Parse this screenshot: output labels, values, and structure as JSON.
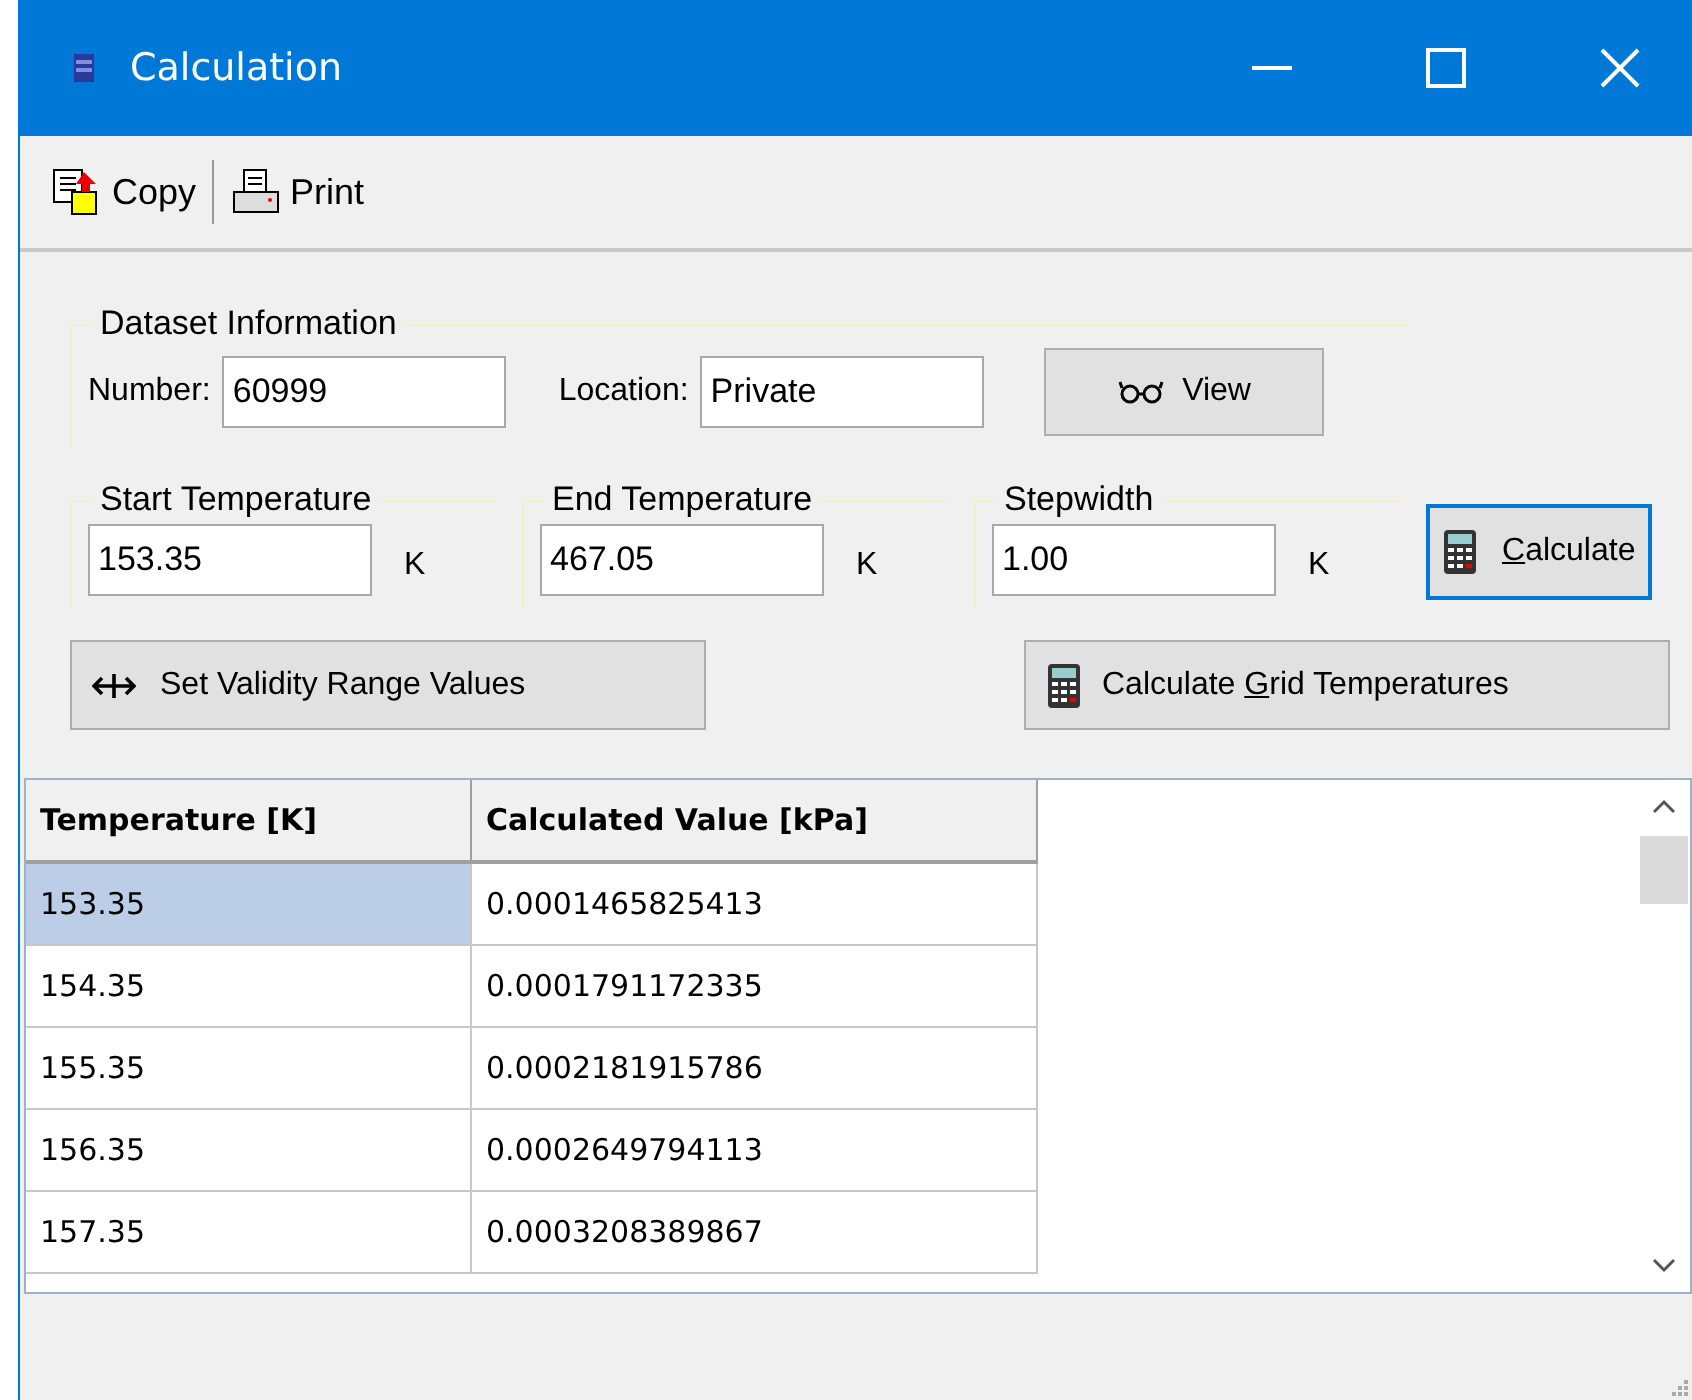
{
  "window": {
    "title": "Calculation"
  },
  "toolbar": [
    {
      "kind": "copy",
      "label": "Copy"
    },
    {
      "kind": "print",
      "label": "Print"
    }
  ],
  "dataset": {
    "legend": "Dataset Information",
    "number_label": "Number:",
    "number": "60999",
    "location_label": "Location:",
    "location": "Private",
    "view_button": "View"
  },
  "ranges": [
    {
      "legend": "Start Temperature",
      "value": "153.35",
      "unit": "K"
    },
    {
      "legend": "End Temperature",
      "value": "467.05",
      "unit": "K"
    },
    {
      "legend": "Stepwidth",
      "value": "1.00",
      "unit": "K"
    }
  ],
  "calculate_button": {
    "key": "C",
    "after": "alculate",
    "focused": true
  },
  "validity_button": {
    "label": "Set Validity Range Values"
  },
  "grid_button": {
    "before": "Calculate ",
    "key": "G",
    "after": "rid Temperatures",
    "focused": false
  },
  "table": {
    "columns": [
      "Temperature [K]",
      "Calculated Value [kPa]"
    ],
    "rows": [
      {
        "cells": [
          "153.35",
          "0.0001465825413"
        ],
        "selected": true
      },
      {
        "cells": [
          "154.35",
          "0.0001791172335"
        ],
        "selected": false
      },
      {
        "cells": [
          "155.35",
          "0.0002181915786"
        ],
        "selected": false
      },
      {
        "cells": [
          "156.35",
          "0.0002649794113"
        ],
        "selected": false
      },
      {
        "cells": [
          "157.35",
          "0.0003208389867"
        ],
        "selected": false
      }
    ]
  }
}
